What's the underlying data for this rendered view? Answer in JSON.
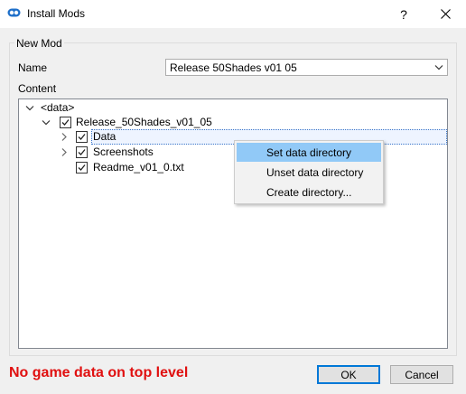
{
  "window": {
    "title": "Install Mods",
    "help_glyph": "?",
    "icons": {
      "app": "mod-organizer-icon",
      "close": "close-icon"
    }
  },
  "group": {
    "title": "New Mod",
    "name_label": "Name",
    "name_value": "Release 50Shades v01 05",
    "content_label": "Content"
  },
  "tree": {
    "root": "<data>",
    "items": [
      {
        "label": "Release_50Shades_v01_05",
        "checked": true,
        "expanded": true
      },
      {
        "label": "Data",
        "checked": true,
        "expanded": false,
        "selected": true
      },
      {
        "label": "Screenshots",
        "checked": true,
        "expanded": false
      },
      {
        "label": "Readme_v01_0.txt",
        "checked": true
      }
    ]
  },
  "context_menu": {
    "items": [
      {
        "label": "Set data directory",
        "highlighted": true
      },
      {
        "label": "Unset data directory"
      },
      {
        "label": "Create directory..."
      }
    ]
  },
  "status": {
    "error": "No game data on top level",
    "error_color": "#e01010"
  },
  "buttons": {
    "ok": "OK",
    "cancel": "Cancel"
  },
  "colors": {
    "accent": "#0078d7",
    "menu_highlight": "#91c9f7"
  }
}
